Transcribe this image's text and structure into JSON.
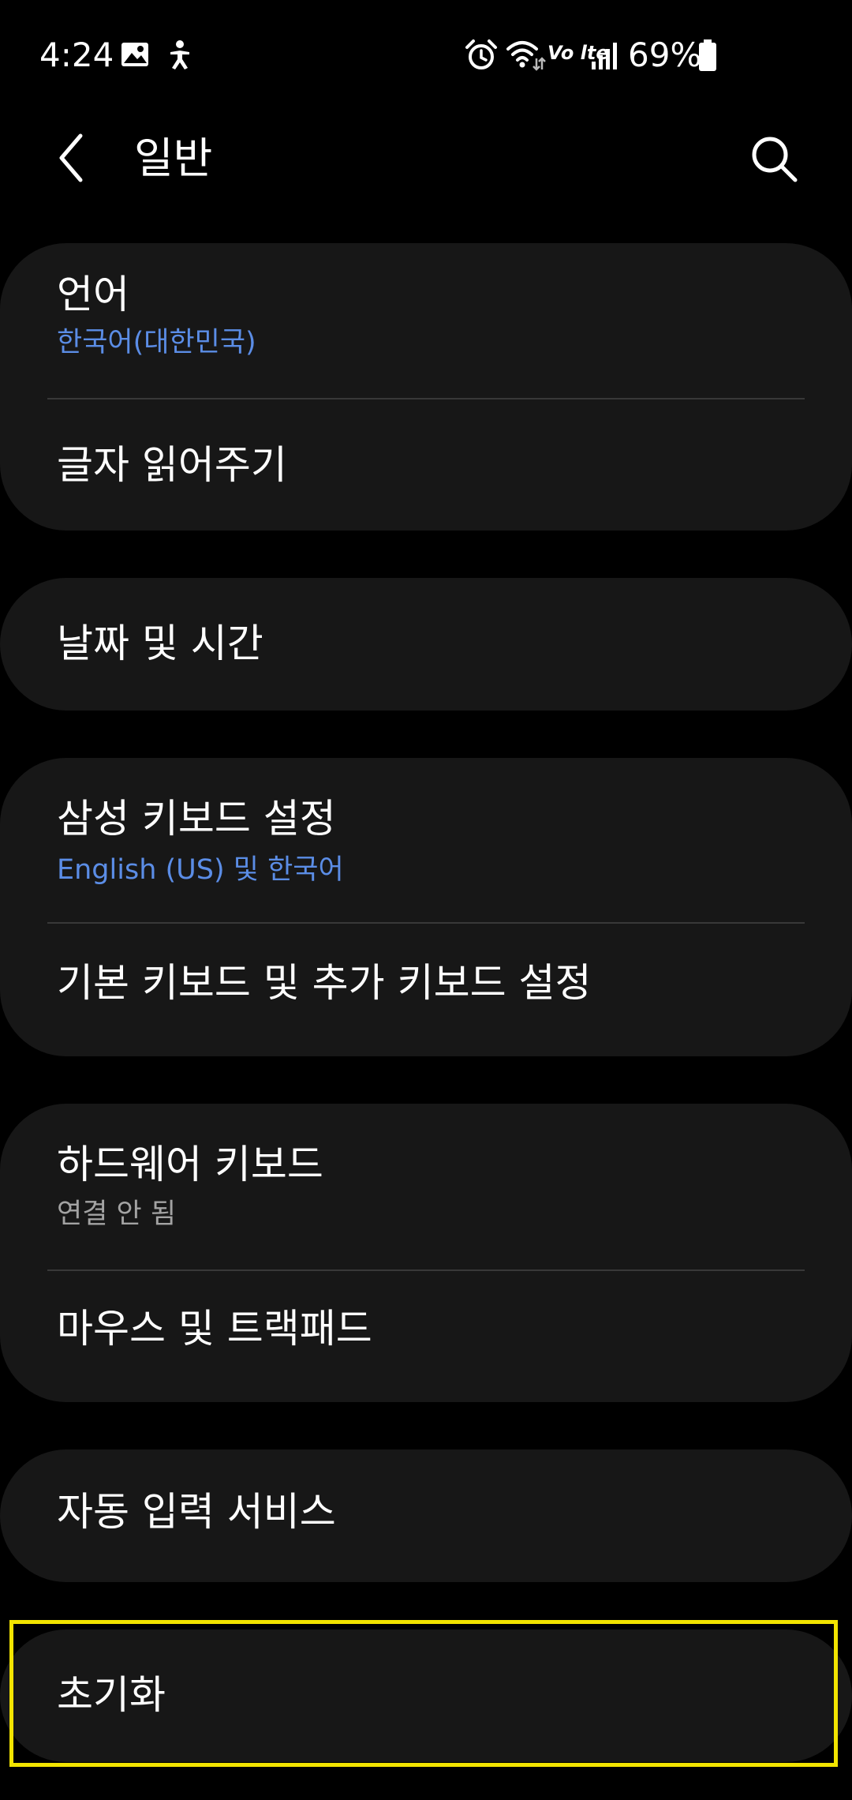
{
  "status_bar": {
    "time": "4:24",
    "network_label": "Vo lte",
    "battery_percent": "69%",
    "icons": [
      "gallery-icon",
      "accessibility-icon",
      "alarm-icon",
      "wifi-icon",
      "volte-icon",
      "signal-icon",
      "battery-icon"
    ]
  },
  "header": {
    "title": "일반",
    "back_icon": "back-arrow-icon",
    "search_icon": "search-icon"
  },
  "groups": [
    {
      "items": [
        {
          "title": "언어",
          "subtitle": "한국어(대한민국)"
        },
        {
          "title": "글자 읽어주기"
        }
      ]
    },
    {
      "items": [
        {
          "title": "날짜 및 시간"
        }
      ]
    },
    {
      "items": [
        {
          "title": "삼성 키보드 설정",
          "subtitle": "English (US) 및 한국어"
        },
        {
          "title": "기본 키보드 및 추가 키보드 설정"
        }
      ]
    },
    {
      "items": [
        {
          "title": "하드웨어 키보드",
          "subtitle": "연결 안 됨"
        },
        {
          "title": "마우스 및 트랙패드"
        }
      ]
    },
    {
      "items": [
        {
          "title": "자동 입력 서비스"
        }
      ]
    },
    {
      "items": [
        {
          "title": "초기화"
        }
      ]
    }
  ],
  "colors": {
    "background": "#000000",
    "card": "#171717",
    "accent_subtitle": "#5b8de6",
    "muted_subtitle": "#a3a3a3",
    "highlight": "#f2e400"
  }
}
